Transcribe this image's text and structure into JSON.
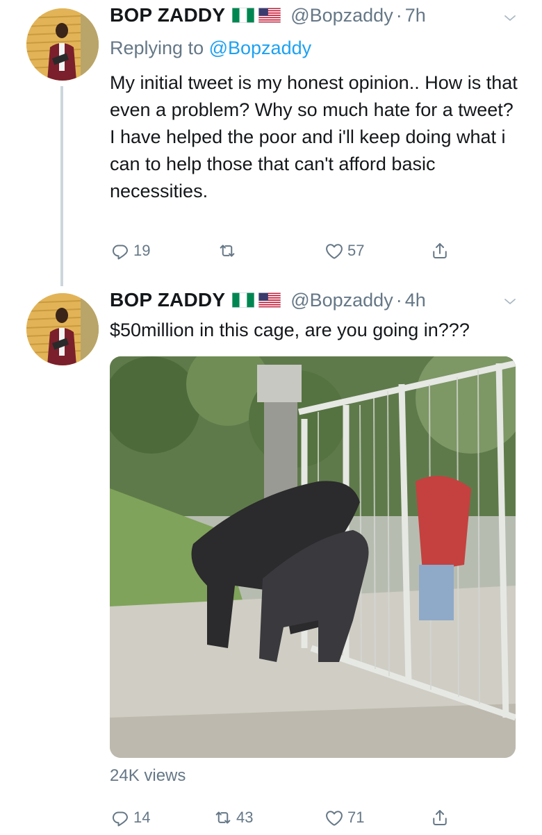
{
  "tweets": [
    {
      "name": "BOP ZADDY",
      "handle": "@Bopzaddy",
      "dot": "·",
      "time": "7h",
      "replying_prefix": "Replying to",
      "replying_to": "@Bopzaddy",
      "paragraphs": [
        "My initial tweet is my honest opinion.. How is that even a problem? Why so much hate for a tweet?",
        "I have helped the poor and i'll keep doing what i can to help those that can't afford basic necessities."
      ],
      "replies": "19",
      "retweets": "",
      "likes": "57"
    },
    {
      "name": "BOP ZADDY",
      "handle": "@Bopzaddy",
      "dot": "·",
      "time": "4h",
      "text": "$50million in this cage, are you going in???",
      "views": "24K views",
      "replies": "14",
      "retweets": "43",
      "likes": "71"
    }
  ],
  "icons": {
    "flag_1": "nigeria-flag-icon",
    "flag_2": "usa-flag-icon",
    "reply": "reply-icon",
    "retweet": "retweet-icon",
    "like": "heart-icon",
    "share": "share-icon",
    "menu": "chevron-down-icon"
  },
  "colors": {
    "text": "#14171a",
    "secondary": "#657786",
    "link": "#1da1f2",
    "thread_line": "#cdd6dd"
  }
}
